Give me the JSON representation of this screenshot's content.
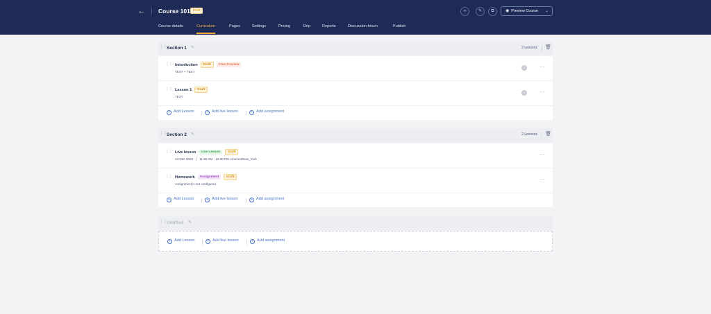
{
  "header": {
    "back_icon": "arrow-left-icon",
    "course_title": "Course 101",
    "status": "Draft",
    "preview_button": "Preview Course",
    "tabs": [
      "Course details",
      "Curriculum",
      "Pages",
      "Settings",
      "Pricing",
      "Drip",
      "Reports",
      "Discussion forum",
      "Publish"
    ],
    "active_tab": "Curriculum"
  },
  "sections": [
    {
      "title": "Section 1",
      "lesson_count": "2 Lessons",
      "items": [
        {
          "title": "Introduction",
          "badges": [
            "Draft",
            "Free Preview"
          ],
          "sub": "TEST + TEXT"
        },
        {
          "title": "Lesson 1",
          "badges": [
            "Draft"
          ],
          "sub": "TEXT"
        }
      ]
    },
    {
      "title": "Section 2",
      "lesson_count": "2 Lessons",
      "items": [
        {
          "title": "Live lesson",
          "badges": [
            "Live Lesson",
            "Draft"
          ],
          "date": "13 Dec 2022",
          "time": "11:30 AM - 12:30 PM America/New_York"
        },
        {
          "title": "Homework",
          "badges": [
            "Assignment",
            "Draft"
          ],
          "sub": "Assignment is not configured."
        }
      ]
    },
    {
      "title": "Untitled"
    }
  ],
  "actions": {
    "add_lesson": "Add Lesson",
    "add_live_lesson": "Add live lesson",
    "add_assignment": "Add assignment"
  }
}
